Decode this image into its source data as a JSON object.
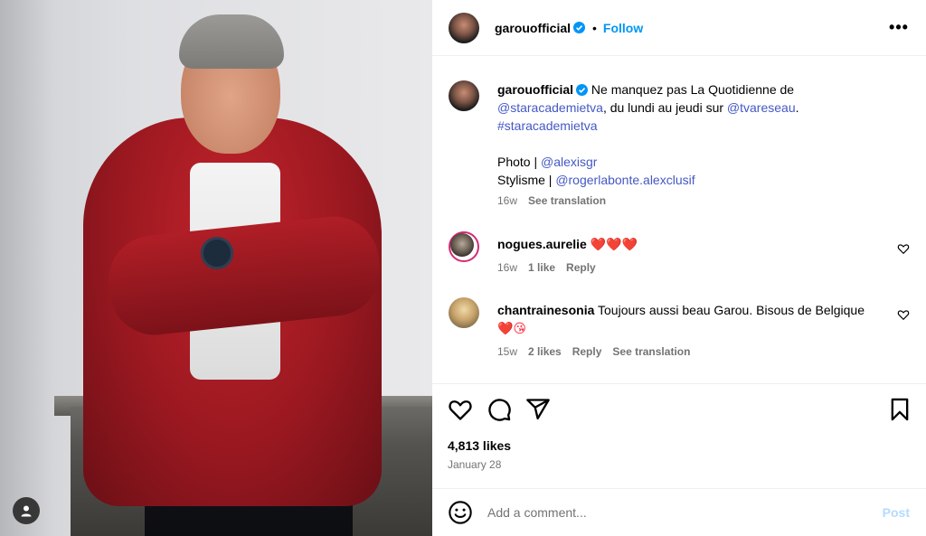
{
  "post": {
    "username": "garouofficial",
    "follow_label": "Follow",
    "separator": "•",
    "more_label": "•••"
  },
  "caption": {
    "username": "garouofficial",
    "text_1": " Ne manquez pas La Quotidienne de ",
    "mention_1": "@staracademietva",
    "text_2": ", du lundi au jeudi sur ",
    "mention_2": "@tvareseau",
    "text_3": ".",
    "hashtag": "#staracademietva",
    "photo_label": "Photo | ",
    "photo_mention": "@alexisgr",
    "style_label": "Stylisme | ",
    "style_mention": "@rogerlabonte.alexclusif",
    "time": "16w",
    "translate": "See translation"
  },
  "comments": [
    {
      "username": "nogues.aurelie",
      "text": "❤️❤️❤️",
      "time": "16w",
      "likes": "1 like",
      "reply": "Reply"
    },
    {
      "username": "chantrainesonia",
      "text": "Toujours aussi beau Garou. Bisous de Belgique",
      "emoji": "❤️😘",
      "time": "15w",
      "likes": "2 likes",
      "reply": "Reply",
      "translate": "See translation"
    }
  ],
  "stats": {
    "likes": "4,813 likes",
    "date": "January 28"
  },
  "composer": {
    "placeholder": "Add a comment...",
    "post_label": "Post"
  },
  "colors": {
    "accent": "#0095f6",
    "link": "#4458c4",
    "heart": "#ff3040",
    "muted": "#737373"
  }
}
